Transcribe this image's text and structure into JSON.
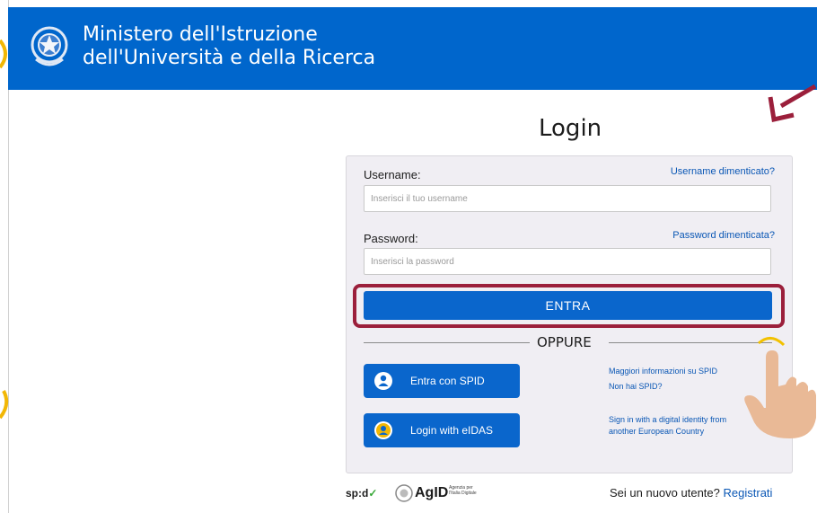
{
  "header": {
    "title_line1": "Ministero dell'Istruzione",
    "title_line2": "dell'Università e della Ricerca"
  },
  "login": {
    "title": "Login",
    "username_label": "Username:",
    "username_forgot": "Username dimenticato?",
    "username_placeholder": "Inserisci il tuo username",
    "password_label": "Password:",
    "password_forgot": "Password dimenticata?",
    "password_placeholder": "Inserisci la password",
    "submit_label": "ENTRA",
    "separator": "OPPURE"
  },
  "alt_login": {
    "spid_button": "Entra con SPID",
    "spid_info": "Maggiori informazioni su SPID",
    "spid_missing": "Non hai SPID?",
    "eidas_button": "Login with eIDAS",
    "eidas_info_line1": "Sign in with a digital identity from",
    "eidas_info_line2": "another European Country"
  },
  "footer": {
    "spid_logo": "sp:d",
    "agid_logo": "AgID",
    "agid_sub": "Agenzia per l'Italia Digitale",
    "new_user_text": "Sei un nuovo utente?",
    "register_link": "Registrati"
  },
  "colors": {
    "header_bg": "#0066cc",
    "button_bg": "#0a66cc",
    "link": "#0a57b5",
    "highlight_border": "#9b1f3b",
    "panel_bg": "#f0eef3"
  },
  "icons": [
    "emblem-icon",
    "spid-user-icon",
    "eidas-icon",
    "agid-logo-icon",
    "pointing-hand-icon",
    "arrow-icon"
  ]
}
